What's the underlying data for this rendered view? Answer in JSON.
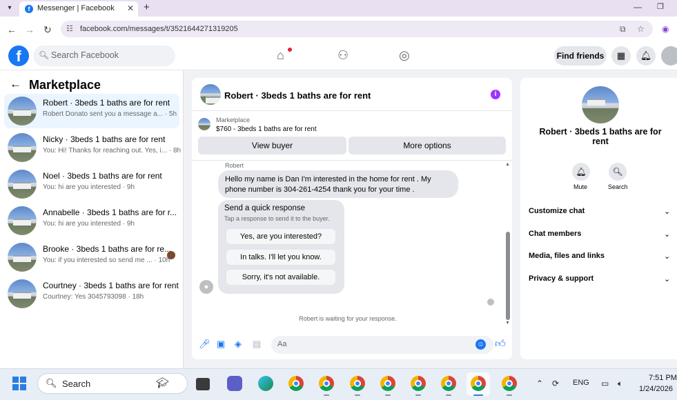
{
  "browser": {
    "tab_title": "Messenger | Facebook",
    "url": "facebook.com/messages/t/3521644271319205"
  },
  "header": {
    "search_placeholder": "Search Facebook",
    "find_friends_label": "Find friends"
  },
  "left": {
    "title": "Marketplace",
    "conversations": [
      {
        "name": "Robert · 3beds 1 baths are for rent",
        "preview": "Robert Donato sent you a message a... · 5h",
        "active": true
      },
      {
        "name": "Nicky · 3beds 1 baths are for rent",
        "preview": "You: Hi! Thanks for reaching out. Yes, i... · 8h"
      },
      {
        "name": "Noel · 3beds 1 baths are for rent",
        "preview": "You: hi are you interested · 9h"
      },
      {
        "name": "Annabelle · 3beds 1 baths are for r...",
        "preview": "You: hi are you interested · 9h"
      },
      {
        "name": "Brooke · 3beds 1 baths are for re...",
        "preview": "You: if you interested so send me ... · 10h"
      },
      {
        "name": "Courtney · 3beds 1 baths are for rent",
        "preview": "Courtney: Yes 3045793098 · 18h"
      }
    ]
  },
  "chat": {
    "title": "Robert · 3beds 1 baths are for rent",
    "marketplace_label": "Marketplace",
    "listing": "$760 - 3beds 1 baths are for rent",
    "view_buyer_label": "View buyer",
    "more_options_label": "More options",
    "sender": "Robert",
    "message": "Hello my name is Dan I'm interested in the home for rent . My phone number is 304-261-4254 thank you for your time .",
    "quick_title": "Send a quick response",
    "quick_subtitle": "Tap a response to send it to the buyer.",
    "quick_replies": [
      "Yes, are you interested?",
      "In talks. I'll let you know.",
      "Sorry, it's not available."
    ],
    "waiting_text": "Robert is waiting for your response.",
    "compose_placeholder": "Aa"
  },
  "right": {
    "name": "Robert · 3beds 1 baths are for rent",
    "mute_label": "Mute",
    "search_label": "Search",
    "sections": [
      "Customize chat",
      "Chat members",
      "Media, files and links",
      "Privacy & support"
    ]
  },
  "taskbar": {
    "search_label": "Search",
    "language": "ENG",
    "time": "7:51 PM",
    "date": "1/24/2026"
  },
  "colors": {
    "accent": "#1877f2",
    "active_row": "#ebf5ff",
    "info": "#a033ff"
  }
}
